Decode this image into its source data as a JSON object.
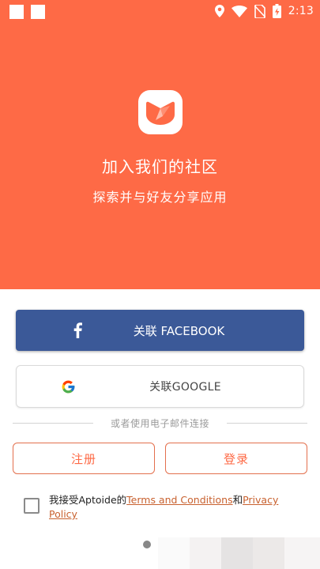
{
  "status_bar": {
    "time": "2:13"
  },
  "hero": {
    "title": "加入我们的社区",
    "subtitle": "探索并与好友分享应用"
  },
  "buttons": {
    "facebook": "关联 FACEBOOK",
    "google": "关联GOOGLE",
    "register": "注册",
    "login": "登录"
  },
  "divider_text": "或者使用电子邮件连接",
  "terms": {
    "prefix": "我接受Aptoide的",
    "terms_link": "Terms and Conditions",
    "and": "和",
    "privacy_link": "Privacy Policy",
    "checked": false
  },
  "pager": {
    "active_index": 0
  },
  "colors": {
    "brand": "#fe6a46",
    "facebook": "#3b5998",
    "outline": "#e3704d",
    "link": "#c8612f"
  },
  "icons": [
    "location-icon",
    "wifi-icon",
    "no-sim-icon",
    "battery-icon",
    "aptoide-logo-icon",
    "facebook-icon",
    "google-icon"
  ]
}
